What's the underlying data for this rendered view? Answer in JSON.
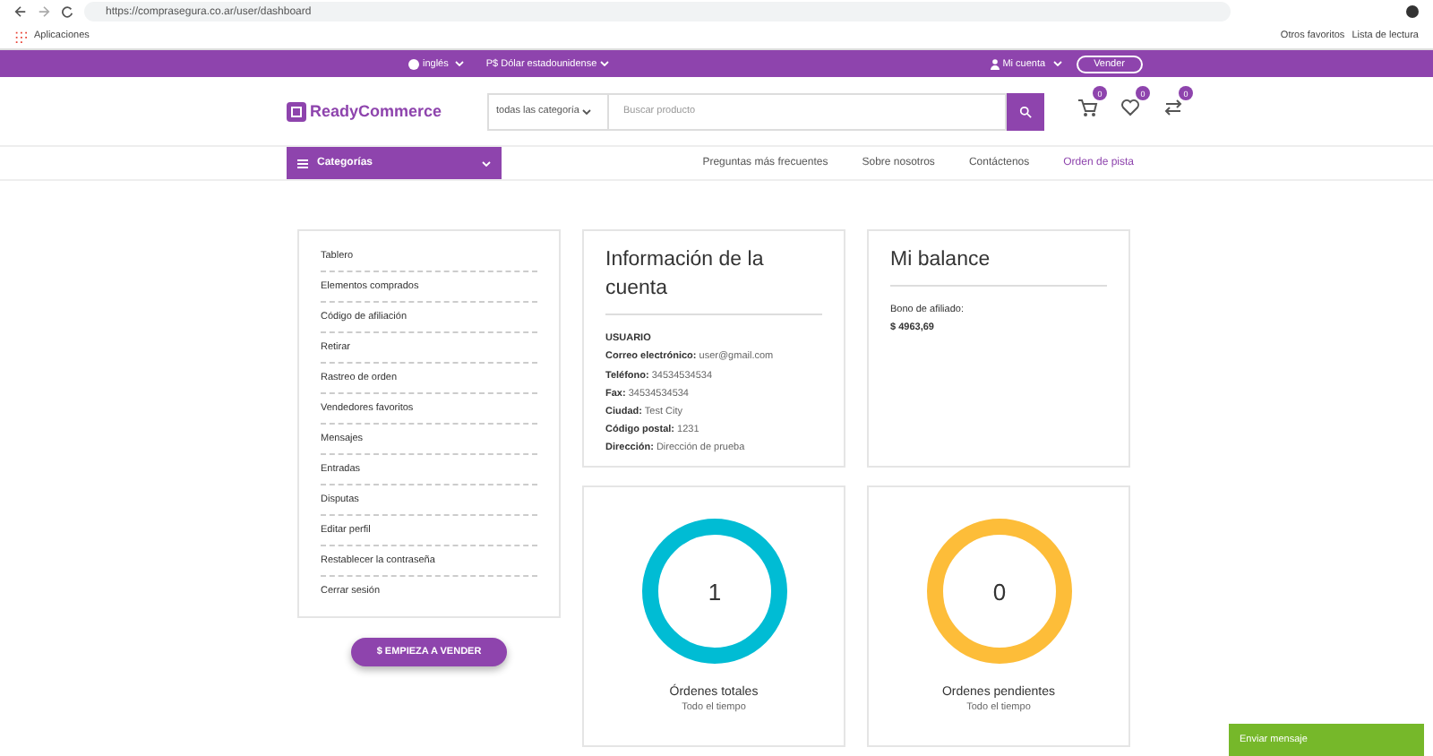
{
  "browser": {
    "url": "https://comprasegura.co.ar/user/dashboard",
    "bookmarks": [
      "Aplicaciones"
    ],
    "right_bookmarks": [
      "Otros favoritos",
      "Lista de lectura"
    ]
  },
  "topbar": {
    "language": "inglés",
    "currency": "P$ Dólar estadounidense",
    "account": "Mi cuenta",
    "sell_button": "Vender"
  },
  "header": {
    "logo": "ReadyCommerce",
    "category_select": "todas las categoría",
    "search": {
      "placeholder": "Buscar producto"
    },
    "icons": [
      {
        "kind": "cart",
        "count": "0"
      },
      {
        "kind": "heart",
        "count": "0"
      },
      {
        "kind": "compare",
        "count": "0"
      }
    ]
  },
  "nav": {
    "categories": "Categorías",
    "links": [
      {
        "label": "Preguntas más frecuentes",
        "selected": false
      },
      {
        "label": "Sobre nosotros",
        "selected": false
      },
      {
        "label": "Contáctenos",
        "selected": false
      },
      {
        "label": "Orden de pista",
        "selected": true
      }
    ]
  },
  "sidebar": {
    "items": [
      "Tablero",
      "Elementos comprados",
      "Código de afiliación",
      "Retirar",
      "Rastreo de orden",
      "Vendedores favoritos",
      "Mensajes",
      "Entradas",
      "Disputas",
      "Editar perfil",
      "Restablecer la contraseña",
      "Cerrar sesión"
    ],
    "button": "$ EMPIEZA A VENDER"
  },
  "account": {
    "title": "Información de la cuenta",
    "role": "USUARIO",
    "fields": [
      {
        "label": "Correo electrónico:",
        "value": "user@gmail.com"
      },
      {
        "label": "Teléfono:",
        "value": "34534534534"
      },
      {
        "label": "Fax:",
        "value": "34534534534"
      },
      {
        "label": "Ciudad:",
        "value": "Test City"
      },
      {
        "label": "Código postal:",
        "value": "1231"
      },
      {
        "label": "Dirección:",
        "value": "Dirección de prueba"
      }
    ]
  },
  "balance": {
    "title": "Mi balance",
    "label": "Bono de afiliado:",
    "amount": "$ 4963,69"
  },
  "stats": [
    {
      "value": "1",
      "title": "Órdenes totales",
      "subtitle": "Todo el tiempo",
      "color": "#00bcd4"
    },
    {
      "value": "0",
      "title": "Ordenes pendientes",
      "subtitle": "Todo el tiempo",
      "color": "#fdbd39"
    }
  ],
  "chat_button": "Enviar mensaje"
}
